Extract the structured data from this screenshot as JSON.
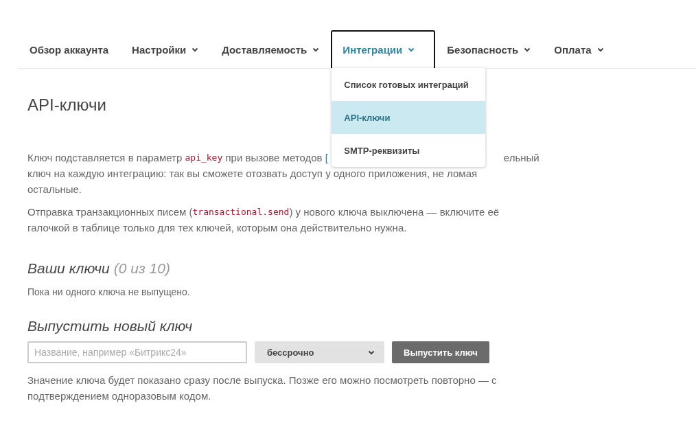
{
  "nav": [
    {
      "label": "Обзор аккаунта",
      "has_caret": false,
      "selected": false
    },
    {
      "label": "Настройки",
      "has_caret": true,
      "selected": false
    },
    {
      "label": "Доставляемость",
      "has_caret": true,
      "selected": false
    },
    {
      "label": "Интеграции",
      "has_caret": true,
      "selected": true,
      "expanded": true,
      "menu": [
        {
          "label": "Список готовых интеграций",
          "selected": false
        },
        {
          "label": "API-ключи",
          "selected": true
        },
        {
          "label": "SMTP-реквизиты",
          "selected": false
        }
      ]
    },
    {
      "label": "Безопасность",
      "has_caret": true,
      "selected": false
    },
    {
      "label": "Оплата",
      "has_caret": true,
      "selected": false
    }
  ],
  "page_title": "API-ключи",
  "intro": [
    [
      {
        "kind": "plain",
        "text": "Ключ подставляется в параметр "
      },
      {
        "kind": "code",
        "text": "api_key"
      },
      {
        "kind": "plain",
        "text": " при вызове методов "
      },
      {
        "kind": "link",
        "text": "["
      },
      {
        "kind": "gap"
      },
      {
        "kind": "plain",
        "text": "ельный"
      }
    ],
    [
      {
        "kind": "plain",
        "text": "ключ на каждую интеграцию: так вы сможете отозвать доступ у одного приложения, не ломая"
      }
    ],
    [
      {
        "kind": "plain",
        "text": "остальные."
      }
    ]
  ],
  "note": [
    [
      {
        "kind": "plain",
        "text": "Отправка транзакционных писем ("
      },
      {
        "kind": "code",
        "text": "transactional.send"
      },
      {
        "kind": "plain",
        "text": ") у нового ключа выключена — включите её"
      }
    ],
    [
      {
        "kind": "plain",
        "text": "галочкой в таблице только для тех ключей, которым она действительно нужна."
      }
    ]
  ],
  "keys_section": {
    "title": "Ваши ключи",
    "count": "(0 из 10)",
    "empty_text": "Пока ни одного ключа не выпущено."
  },
  "new_key": {
    "title": "Выпустить новый ключ",
    "name_field": {
      "placeholder": "Название, например «Битрикс24»"
    },
    "term_select": {
      "value": "бессрочно"
    },
    "button": "Выпустить ключ",
    "hint": [
      "Значение ключа будет показано сразу после выпуска. Позже его можно посмотреть повторно — с",
      "подтверждением одноразовым кодом."
    ]
  }
}
